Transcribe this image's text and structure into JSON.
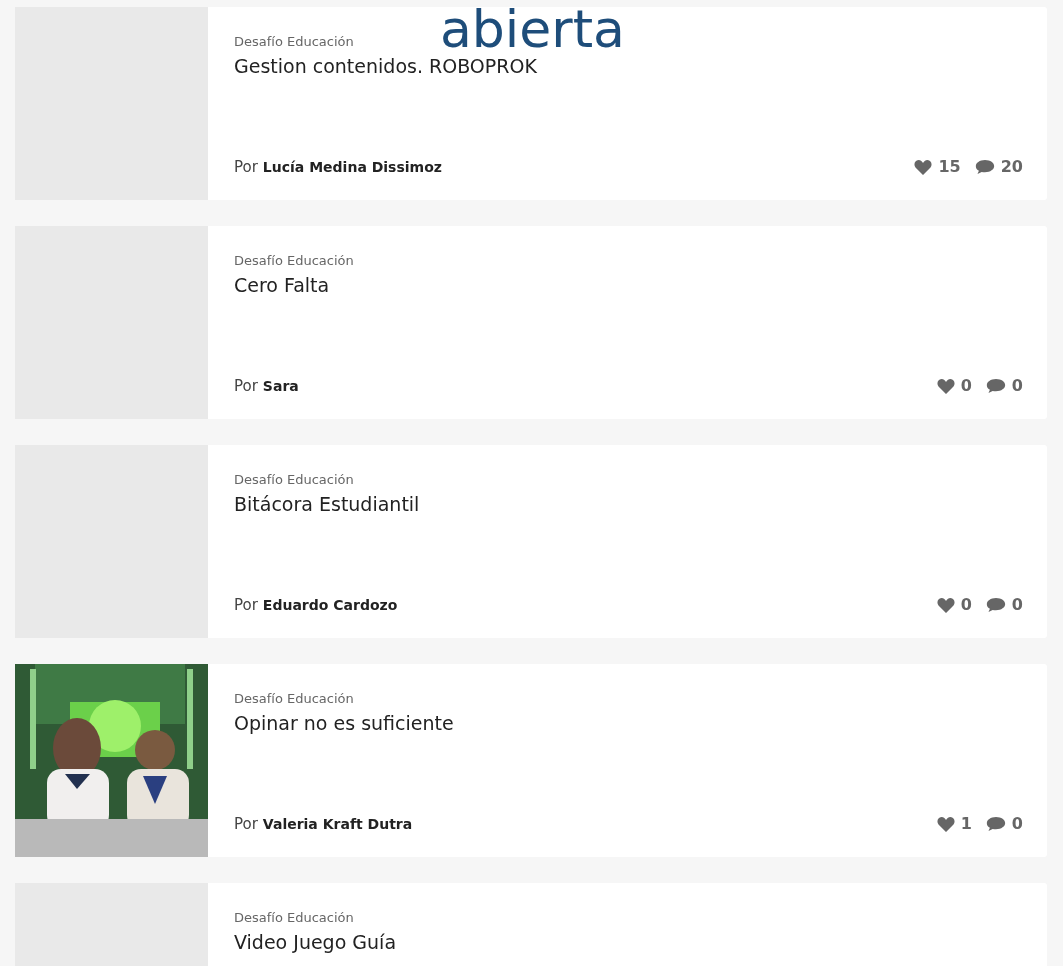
{
  "overlay_text": "abierta",
  "posts": [
    {
      "category": "Desafío Educación",
      "title": "Gestion contenidos. ROBOPROK",
      "by": "Por",
      "author": "Lucía Medina Dissimoz",
      "likes": "15",
      "comments": "20",
      "thumbnail": {
        "kind": "placeholder"
      }
    },
    {
      "category": "Desafío Educación",
      "title": "Cero Falta",
      "by": "Por",
      "author": "Sara",
      "likes": "0",
      "comments": "0",
      "thumbnail": {
        "kind": "placeholder"
      }
    },
    {
      "category": "Desafío Educación",
      "title": "Bitácora Estudiantil",
      "by": "Por",
      "author": "Eduardo Cardozo",
      "likes": "0",
      "comments": "0",
      "thumbnail": {
        "kind": "placeholder"
      }
    },
    {
      "category": "Desafío Educación",
      "title": "Opinar no es suficiente",
      "by": "Por",
      "author": "Valeria Kraft Dutra",
      "likes": "1",
      "comments": "0"
    },
    {
      "category": "Desafío Educación",
      "title": "Video Juego Guía",
      "thumbnail": {
        "kind": "placeholder"
      }
    }
  ]
}
